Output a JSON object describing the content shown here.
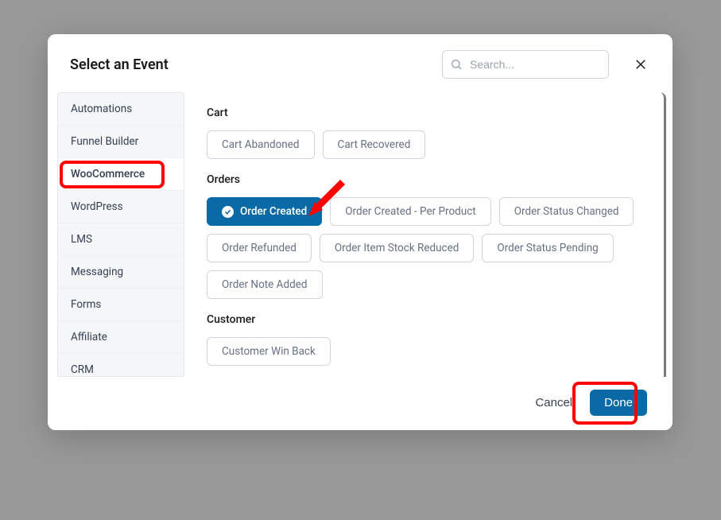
{
  "header": {
    "title": "Select an Event",
    "search_placeholder": "Search..."
  },
  "sidebar": {
    "items": [
      {
        "label": "Automations",
        "active": false
      },
      {
        "label": "Funnel Builder",
        "active": false
      },
      {
        "label": "WooCommerce",
        "active": true
      },
      {
        "label": "WordPress",
        "active": false
      },
      {
        "label": "LMS",
        "active": false
      },
      {
        "label": "Messaging",
        "active": false
      },
      {
        "label": "Forms",
        "active": false
      },
      {
        "label": "Affiliate",
        "active": false
      },
      {
        "label": "CRM",
        "active": false
      }
    ]
  },
  "sections": [
    {
      "title": "Cart",
      "events": [
        {
          "label": "Cart Abandoned",
          "selected": false
        },
        {
          "label": "Cart Recovered",
          "selected": false
        }
      ]
    },
    {
      "title": "Orders",
      "events": [
        {
          "label": "Order Created",
          "selected": true
        },
        {
          "label": "Order Created - Per Product",
          "selected": false
        },
        {
          "label": "Order Status Changed",
          "selected": false
        },
        {
          "label": "Order Refunded",
          "selected": false
        },
        {
          "label": "Order Item Stock Reduced",
          "selected": false
        },
        {
          "label": "Order Status Pending",
          "selected": false
        },
        {
          "label": "Order Note Added",
          "selected": false
        }
      ]
    },
    {
      "title": "Customer",
      "events": [
        {
          "label": "Customer Win Back",
          "selected": false
        }
      ]
    }
  ],
  "footer": {
    "cancel_label": "Cancel",
    "done_label": "Done"
  },
  "colors": {
    "accent": "#0a6aa5",
    "annotation": "#ff0000"
  }
}
